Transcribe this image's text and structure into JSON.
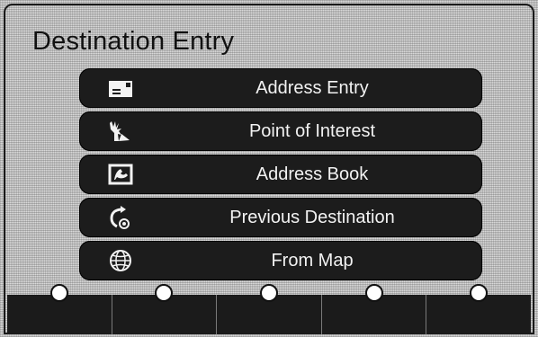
{
  "screen": {
    "title": "Destination Entry"
  },
  "menu": {
    "items": [
      {
        "label": "Address Entry",
        "icon": "address-card-icon"
      },
      {
        "label": "Point of Interest",
        "icon": "statue-of-liberty-icon"
      },
      {
        "label": "Address Book",
        "icon": "address-book-icon"
      },
      {
        "label": "Previous Destination",
        "icon": "previous-destination-icon"
      },
      {
        "label": "From Map",
        "icon": "globe-icon"
      }
    ]
  },
  "soft_keys": {
    "count": 5
  },
  "colors": {
    "button_bg": "#1c1c1c",
    "button_text": "#f2f2f2",
    "screen_bg": "#d9d9d9"
  }
}
